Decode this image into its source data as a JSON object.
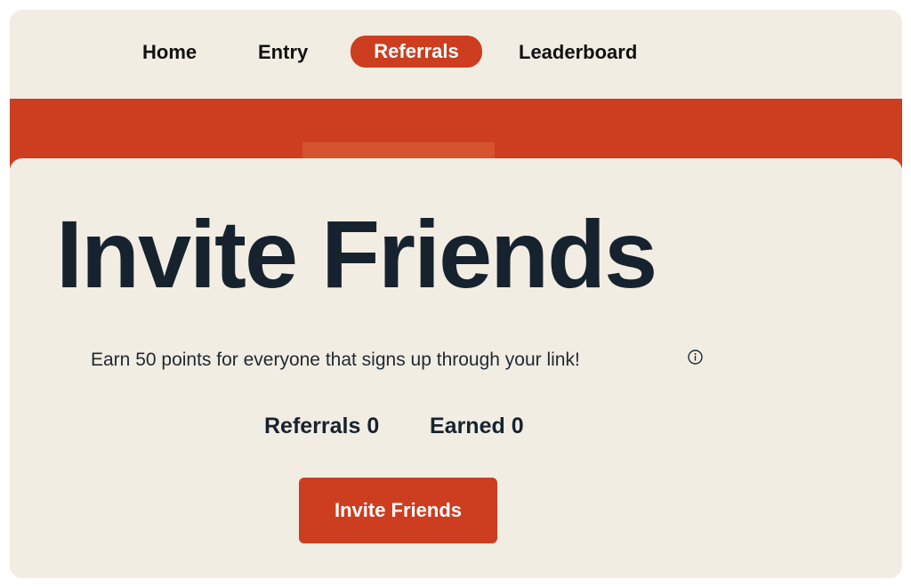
{
  "nav": {
    "items": [
      {
        "label": "Home",
        "active": false
      },
      {
        "label": "Entry",
        "active": false
      },
      {
        "label": "Referrals",
        "active": true
      },
      {
        "label": "Leaderboard",
        "active": false
      }
    ]
  },
  "hero": {
    "title": "Invite Friends",
    "description": "Earn 50 points for everyone that signs up through your link!",
    "info_icon": "info-circle-icon"
  },
  "stats": {
    "referrals_label": "Referrals",
    "referrals_value": "0",
    "earned_label": "Earned",
    "earned_value": "0"
  },
  "cta": {
    "label": "Invite Friends"
  },
  "colors": {
    "accent": "#cd3d1f",
    "background": "#f2ede3",
    "heading": "#16232f"
  }
}
